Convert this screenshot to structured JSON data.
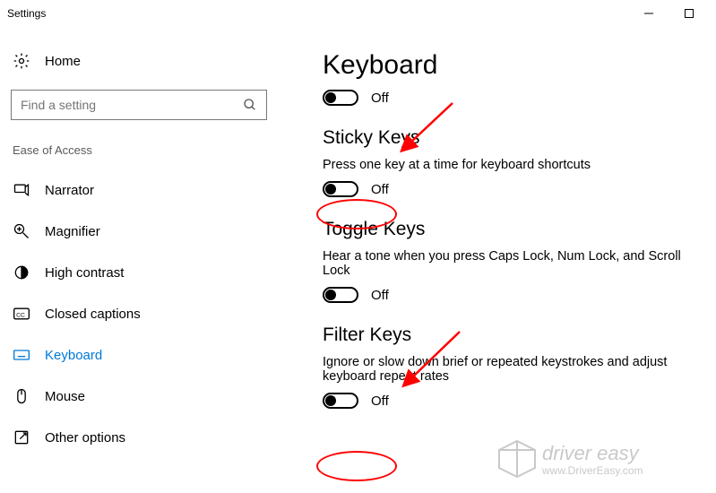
{
  "window": {
    "title": "Settings"
  },
  "sidebar": {
    "home_label": "Home",
    "search_placeholder": "Find a setting",
    "category": "Ease of Access",
    "items": [
      {
        "label": "Narrator"
      },
      {
        "label": "Magnifier"
      },
      {
        "label": "High contrast"
      },
      {
        "label": "Closed captions"
      },
      {
        "label": "Keyboard"
      },
      {
        "label": "Mouse"
      },
      {
        "label": "Other options"
      }
    ]
  },
  "main": {
    "page_title": "Keyboard",
    "top_toggle_label": "Off",
    "sections": {
      "sticky": {
        "heading": "Sticky Keys",
        "desc": "Press one key at a time for keyboard shortcuts",
        "toggle_label": "Off"
      },
      "toggle": {
        "heading": "Toggle Keys",
        "desc": "Hear a tone when you press Caps Lock, Num Lock, and Scroll Lock",
        "toggle_label": "Off"
      },
      "filter": {
        "heading": "Filter Keys",
        "desc": "Ignore or slow down brief or repeated keystrokes and adjust keyboard repeat rates",
        "toggle_label": "Off"
      }
    }
  },
  "watermark": {
    "line1": "driver easy",
    "line2": "www.DriverEasy.com"
  }
}
